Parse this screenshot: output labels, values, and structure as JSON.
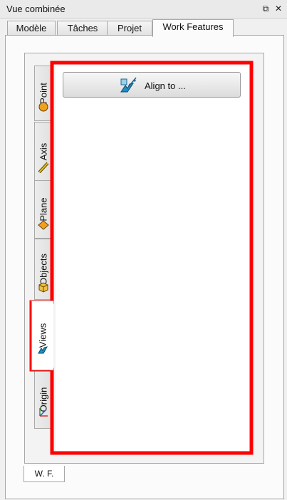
{
  "window": {
    "title": "Vue combinée",
    "float_icon": "restore-window-icon",
    "close_icon": "close-icon"
  },
  "top_tabs": [
    {
      "label": "Modèle",
      "active": false
    },
    {
      "label": "Tâches",
      "active": false
    },
    {
      "label": "Projet",
      "active": false
    },
    {
      "label": "Work Features",
      "active": true
    }
  ],
  "side_tabs": [
    {
      "label": "Point",
      "icon": "point-icon",
      "active": false
    },
    {
      "label": "Axis",
      "icon": "axis-icon",
      "active": false
    },
    {
      "label": "Plane",
      "icon": "plane-icon",
      "active": false
    },
    {
      "label": "Objects",
      "icon": "objects-icon",
      "active": false
    },
    {
      "label": "Views",
      "icon": "views-icon",
      "active": true
    },
    {
      "label": "Origin",
      "icon": "origin-icon",
      "active": false
    }
  ],
  "views_panel": {
    "align_button": {
      "label": "Align to ...",
      "icon": "align-view-icon"
    }
  },
  "bottom_tab": {
    "label": "W. F."
  },
  "colors": {
    "highlight": "#ff0000",
    "background": "#f0f0f0",
    "tab_active": "#fbfbfb"
  }
}
